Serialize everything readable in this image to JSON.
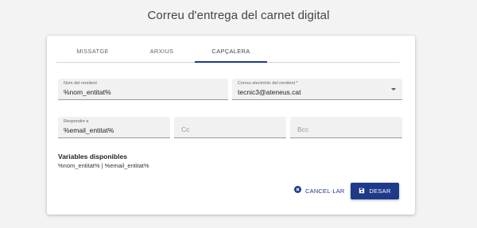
{
  "page": {
    "title": "Correu d'entrega del carnet digital"
  },
  "tabs": [
    {
      "label": "MISSATGE",
      "active": false
    },
    {
      "label": "ARXIUS",
      "active": false
    },
    {
      "label": "CAPÇALERA",
      "active": true
    }
  ],
  "form": {
    "sender_name": {
      "label": "Nom del remitent",
      "value": "%nom_entitat%"
    },
    "sender_email": {
      "label": "Correu electrònic del remitent *",
      "value": "tecnic3@ateneus.cat"
    },
    "reply_to": {
      "label": "Respondre a",
      "value": "%email_entitat%"
    },
    "cc": {
      "placeholder": "Cc",
      "value": ""
    },
    "bcc": {
      "placeholder": "Bcc",
      "value": ""
    }
  },
  "variables": {
    "title": "Variables disponibles",
    "list": "%nom_entitat% | %email_entitat%"
  },
  "actions": {
    "cancel_label": "CANCEL·LAR",
    "save_label": "DESAR"
  },
  "colors": {
    "accent": "#1e3a8a",
    "background": "#f3f3f3",
    "field_bg": "#f1f1f1"
  },
  "icons": {
    "cancel": "close-circle-icon",
    "save": "floppy-disk-icon",
    "dropdown": "caret-down-icon"
  }
}
